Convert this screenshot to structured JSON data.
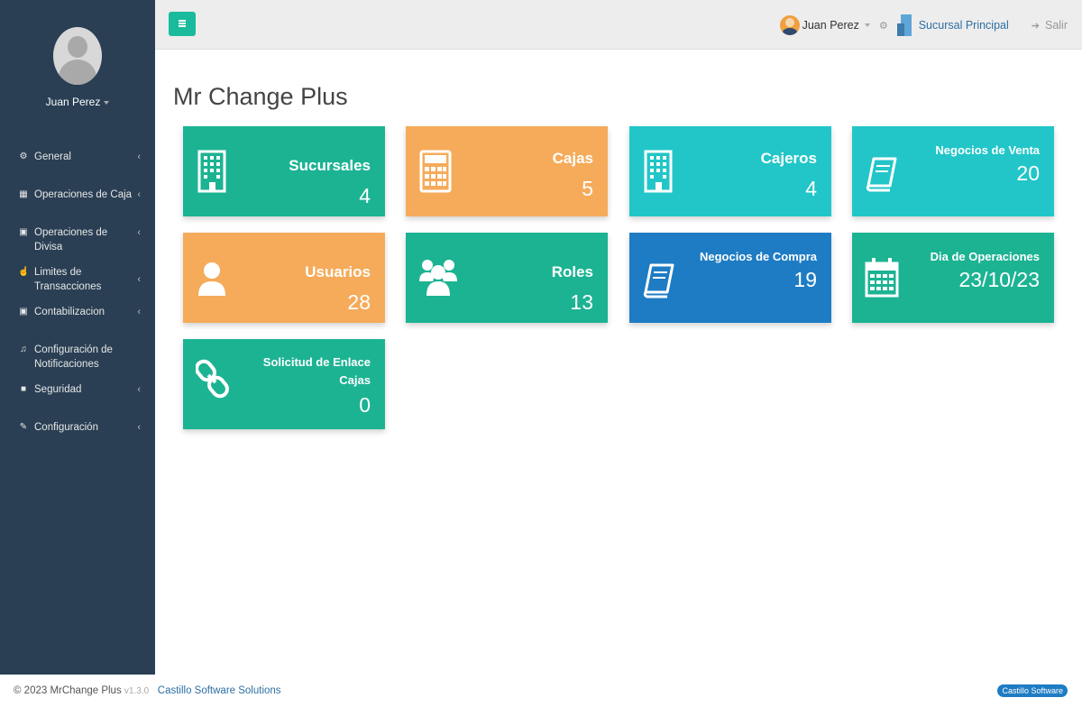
{
  "sidebar": {
    "profile_name": "Juan Perez",
    "items": [
      {
        "label": "General",
        "icon": "gears-icon"
      },
      {
        "label": "Operaciones de Caja",
        "icon": "calculator-icon"
      },
      {
        "label": "Operaciones de Divisa",
        "icon": "money-icon"
      },
      {
        "label": "Limites de Transacciones",
        "icon": "hand-icon"
      },
      {
        "label": "Contabilizacion",
        "icon": "money-icon"
      },
      {
        "label": "Configuración de Notificaciones",
        "icon": "bell-icon"
      },
      {
        "label": "Seguridad",
        "icon": "lock-icon"
      },
      {
        "label": "Configuración",
        "icon": "wrench-icon"
      }
    ]
  },
  "topnav": {
    "user_name": "Juan Perez",
    "branch": "Sucursal Principal",
    "exit": "Salir"
  },
  "page": {
    "title": "Mr Change Plus"
  },
  "tiles": [
    {
      "title": "Sucursales",
      "value": "4",
      "color": "#1cb393",
      "icon": "building-icon"
    },
    {
      "title": "Cajas",
      "value": "5",
      "color": "#f5ab5a",
      "icon": "calculator-icon"
    },
    {
      "title": "Cajeros",
      "value": "4",
      "color": "#22c6c8",
      "icon": "building-icon"
    },
    {
      "title": "Negocios de Venta",
      "value": "20",
      "color": "#22c6c8",
      "icon": "book-icon"
    },
    {
      "title": "Usuarios",
      "value": "28",
      "color": "#f5ab5a",
      "icon": "user-icon"
    },
    {
      "title": "Roles",
      "value": "13",
      "color": "#1cb393",
      "icon": "users-icon"
    },
    {
      "title": "Negocios de Compra",
      "value": "19",
      "color": "#1e7cc4",
      "icon": "book-icon"
    },
    {
      "title": "Dia de Operaciones",
      "value": "23/10/23",
      "color": "#1cb393",
      "icon": "calendar-icon"
    },
    {
      "title": "Solicitud de Enlace Cajas",
      "value": "0",
      "color": "#1cb393",
      "icon": "link-icon"
    }
  ],
  "footer": {
    "copyright": "© 2023 MrChange Plus",
    "version": "v1.3.0",
    "company": "Castillo Software Solutions",
    "badge": "Castillo Software"
  }
}
